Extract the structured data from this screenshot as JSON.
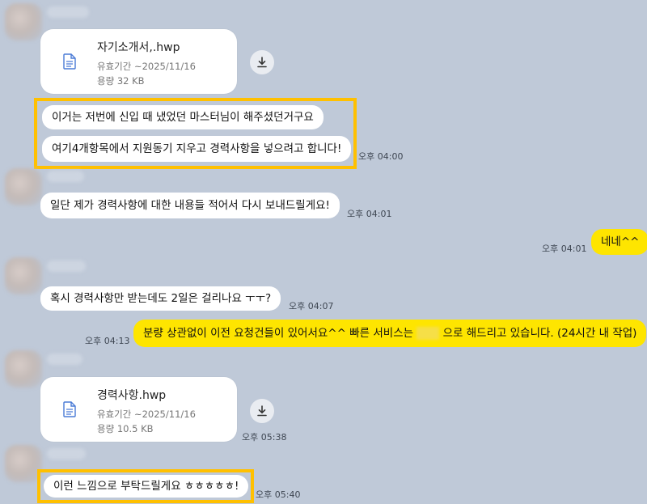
{
  "chat": {
    "file1": {
      "name": "자기소개서,.hwp",
      "expiry": "유효기간 ~2025/11/16",
      "size": "용량 32 KB"
    },
    "msg1": "이거는 저번에 신입 때 냈었던 마스터님이 해주셨던거구요",
    "msg2": "여기4개항목에서 지원동기 지우고 경력사항을 넣으려고 합니다!",
    "time1": "오후 04:00",
    "msg3": "일단 제가 경력사항에 대한 내용들 적어서 다시 보내드릴게요!",
    "time2": "오후 04:01",
    "mine1": "네네^^",
    "time3": "오후 04:01",
    "msg4": "혹시 경력사항만 받는데도 2일은 걸리나요 ㅜㅜ?",
    "time4": "오후 04:07",
    "mine2_a": "분량 상관없이 이전 요청건들이 있어서요^^ 빠른 서비스는",
    "mine2_b": "으로 해드리고 있습니다. (24시간 내 작업)",
    "time5": "오후 04:13",
    "file2": {
      "name": "경력사항.hwp",
      "expiry": "유효기간 ~2025/11/16",
      "size": "용량 10.5 KB"
    },
    "time6": "오후 05:38",
    "msg5": "이런 느낌으로 부탁드릴게요 ㅎㅎㅎㅎㅎ!",
    "time7": "오후 05:40"
  },
  "colors": {
    "background": "#bfc9d8",
    "my_bubble": "#fee500",
    "highlight": "#ffc000",
    "file_icon": "#4a7bd6"
  },
  "icons": {
    "file": "document-icon",
    "download": "download-arrow-icon"
  }
}
